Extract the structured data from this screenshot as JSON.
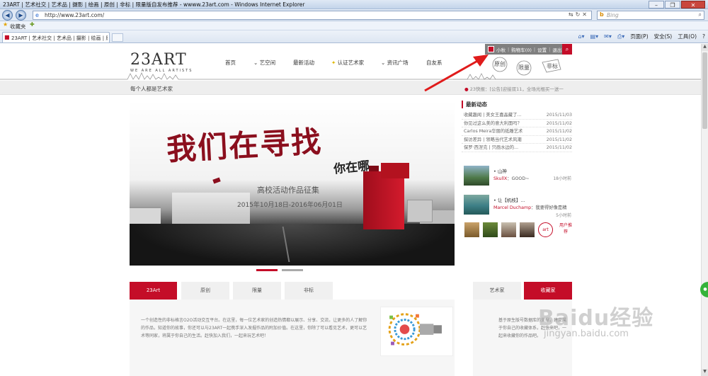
{
  "window": {
    "title": "23ART | 艺术社交 | 艺术品 | 摄影 | 绘画 | 原创 | 非标 | 限量版自发布推荐 - wwww.23art.com - Windows Internet Explorer"
  },
  "address_bar": {
    "url": "http://www.23art.com/",
    "search_placeholder": "Bing"
  },
  "favorites_bar": {
    "label": "收藏夹"
  },
  "tabs": [
    {
      "label": "23ART | 艺术社交 | 艺术品 | 摄影 | 绘画 | 原创..."
    }
  ],
  "command_bar": {
    "page": "页面(P)",
    "safety": "安全(S)",
    "tools": "工具(O)",
    "help": "?"
  },
  "site": {
    "logo": "23ART",
    "logo_tagline": "WE ARE ALL ARTISTS",
    "userbar": {
      "username": "小秋",
      "cart": "购物车(0)",
      "settings": "设置",
      "logout": "退出"
    },
    "nav": [
      "首页",
      "艺空间",
      "最新活动",
      "认证艺术家",
      "资讯广场",
      "自友系"
    ],
    "deco_tags": [
      "原创",
      "限量",
      "非标"
    ],
    "motto": "每个人都是艺术家",
    "ticker": "23快报：[公告]迎接双11，全场光棍买一送一"
  },
  "banner": {
    "headline": "我们在寻找",
    "subheadline": "你在哪",
    "title": "高校活动作品征集",
    "dates": "2015年10月18日-2016年06月01日"
  },
  "sidebar": {
    "title": "最新动态",
    "news": [
      {
        "title": "收藏趣闻 | 美女王嘉晶藏了...",
        "date": "2015/11/03"
      },
      {
        "title": "你见过这么美的意大利面吗？",
        "date": "2015/11/02"
      },
      {
        "title": "Carlos Meira华丽的纸雕艺术",
        "date": "2015/11/02"
      },
      {
        "title": "探访差异 | 领略当代艺术风潮",
        "date": "2015/11/02"
      },
      {
        "title": "保罗·西涅克 | 只画水边的...",
        "date": "2015/11/02"
      }
    ],
    "feed": [
      {
        "line1": "• 山神",
        "user": "SkullX",
        "comment": "：GOOD~",
        "time": "18小时前",
        "time2": ""
      },
      {
        "line1": "• 让【机枝】...",
        "user": "Marcel Duchamp",
        "comment": "：我要得好像是精",
        "time": "",
        "time2": "5小时前"
      }
    ],
    "recommend_label": "用户推荐"
  },
  "content_tabs": {
    "left": [
      "23Art",
      "原创",
      "限量",
      "非标"
    ],
    "right": [
      "艺术家",
      "收藏家"
    ]
  },
  "intro": {
    "text": "一个创造性的非标格言O2O活动交互平台。在这里，每一位艺术家的创造热情都以展示、分享、交流，让更多的人了解你的作品，知道你的故事，你还可以与23ART一起携手深入发掘作品的附加价值。在这里，你除了可以看见艺术，更可以艺术等同家，将属于你自己的生活。赶快加入我们，一起来玩艺术吧！",
    "right_text": "基于原生版号数据库的支撑，建立属于你自己的收藏体系，赶快来吧，一起来收藏你的作品吧。"
  },
  "watermark": {
    "main": "Baidu经验",
    "sub": "jingyan.baidu.com"
  },
  "colors": {
    "brand_red": "#c40d28",
    "userbar_grey": "#7f7f7f"
  }
}
